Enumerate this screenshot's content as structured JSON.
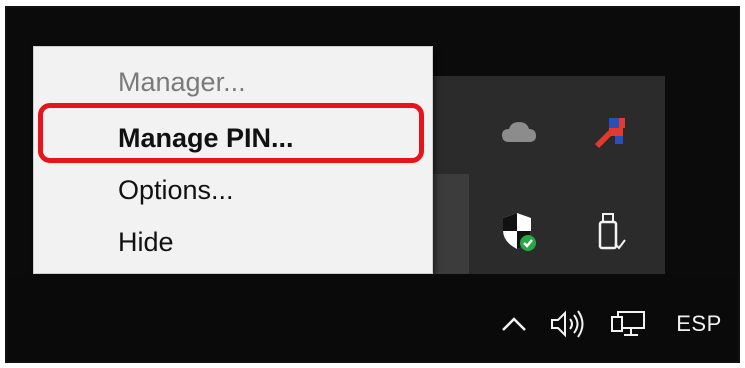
{
  "context_menu": {
    "items": [
      {
        "label": "Manager...",
        "state": "disabled"
      },
      {
        "label": "Manage PIN...",
        "state": "highlighted"
      },
      {
        "label": "Options...",
        "state": "normal"
      },
      {
        "label": "Hide",
        "state": "normal"
      }
    ],
    "highlight_color": "#e8131b"
  },
  "overflow_tray": {
    "icons": [
      "cloud-icon",
      "pin-app-icon",
      "defender-shield-icon",
      "usb-drive-icon"
    ]
  },
  "taskbar": {
    "tray_icons": [
      "chevron-up-icon",
      "volume-icon",
      "network-icon"
    ],
    "language": "ESP"
  },
  "colors": {
    "taskbar_bg": "#0a0a0a",
    "menu_bg": "#f2f2f2",
    "overflow_bg": "#2b2b2b"
  }
}
